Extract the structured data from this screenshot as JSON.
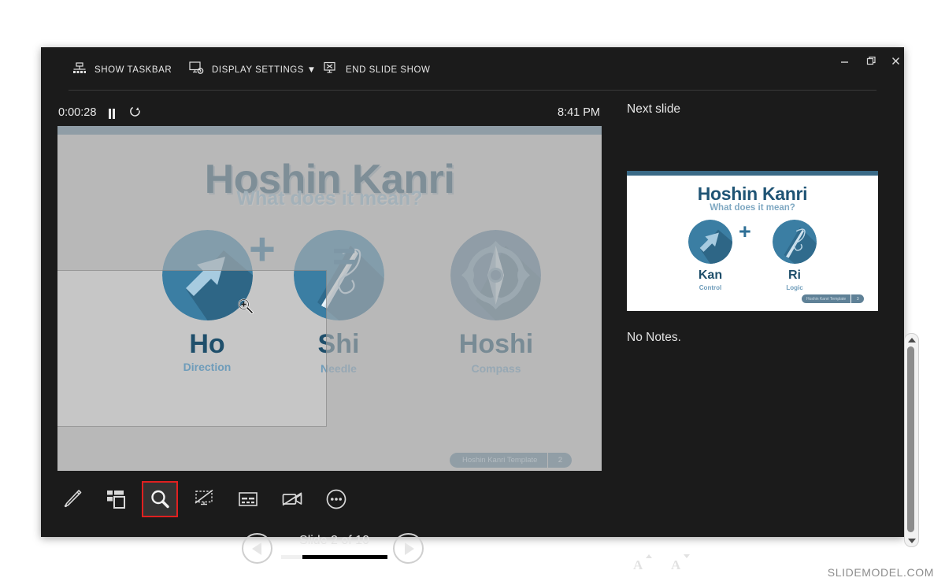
{
  "app": {
    "name": "PowerPoint Presenter View"
  },
  "topbar": {
    "items": [
      {
        "label": "SHOW TASKBAR",
        "icon": "taskbar-icon"
      },
      {
        "label": "DISPLAY SETTINGS ▼",
        "icon": "display-settings-icon"
      },
      {
        "label": "END SLIDE SHOW",
        "icon": "end-slide-show-icon"
      }
    ],
    "window_controls": [
      {
        "name": "minimize",
        "glyph": "minimize-icon"
      },
      {
        "name": "restore",
        "glyph": "restore-icon"
      },
      {
        "name": "close",
        "glyph": "close-icon"
      }
    ]
  },
  "timer": {
    "elapsed": "0:00:28",
    "pause_label": "pause-icon",
    "restart_label": "restart-icon",
    "clock": "8:41 PM"
  },
  "current_slide": {
    "title": "Hoshin Kanri",
    "subtitle": "What does it mean?",
    "terms": [
      {
        "main": "Ho",
        "sub": "Direction",
        "icon": "arrow-up-right-icon"
      },
      {
        "main": "Shi",
        "sub": "Needle",
        "icon": "needle-thread-icon"
      },
      {
        "main": "Hoshi",
        "sub": "Compass",
        "icon": "compass-icon"
      }
    ],
    "operators": {
      "plus": "+",
      "equals": "="
    },
    "footer": {
      "name": "Hoshin Kanri Template",
      "number": "2"
    },
    "zoom_mode_active": true,
    "cursor": "magnifier-cursor"
  },
  "toolbar": {
    "tools": [
      {
        "name": "pen-icon",
        "label": "Pen",
        "active": false
      },
      {
        "name": "all-slides-icon",
        "label": "See all slides",
        "active": false
      },
      {
        "name": "zoom-icon",
        "label": "Zoom into the slide",
        "active": true
      },
      {
        "name": "black-screen-icon",
        "label": "Black or unblack slide show",
        "active": false
      },
      {
        "name": "subtitles-icon",
        "label": "Toggle subtitles",
        "active": false
      },
      {
        "name": "stop-video-icon",
        "label": "Stop camera",
        "active": false
      },
      {
        "name": "more-options-icon",
        "label": "More slide show options",
        "active": false
      }
    ]
  },
  "navigation": {
    "previous_label": "previous-slide-icon",
    "next_label": "next-slide-icon",
    "counter": "Slide 2 of 10",
    "current": 2,
    "total": 10,
    "progress_percent": 20
  },
  "right_panel": {
    "next_slide_label": "Next slide",
    "next_slide": {
      "title": "Hoshin Kanri",
      "subtitle": "What does it mean?",
      "terms": [
        {
          "main": "Kan",
          "sub": "Control",
          "icon": "arrow-up-right-icon"
        },
        {
          "main": "Ri",
          "sub": "Logic",
          "icon": "needle-thread-icon"
        }
      ],
      "plus": "+",
      "footer": {
        "name": "Hoshin Kanri Template",
        "number": "3"
      }
    },
    "notes": {
      "text": "No Notes.",
      "scrollbar": {
        "up": "scroll-up-icon",
        "down": "scroll-down-icon"
      }
    },
    "font_buttons": [
      {
        "name": "increase-font-size",
        "glyph": "A"
      },
      {
        "name": "decrease-font-size",
        "glyph": "A"
      }
    ]
  },
  "watermark": "SLIDEMODEL.COM",
  "colors": {
    "window_bg": "#1b1b1b",
    "slide_accent": "#5a7e95",
    "slide_title": "#2d586f",
    "slide_subtitle": "#8fb3c9",
    "term_main": "#1f4f6b",
    "term_sub": "#6e9cba",
    "icon_circle": "#3b7ea3",
    "active_tool_outline": "#e02020",
    "masked_overlay": "#b4b4b4"
  }
}
